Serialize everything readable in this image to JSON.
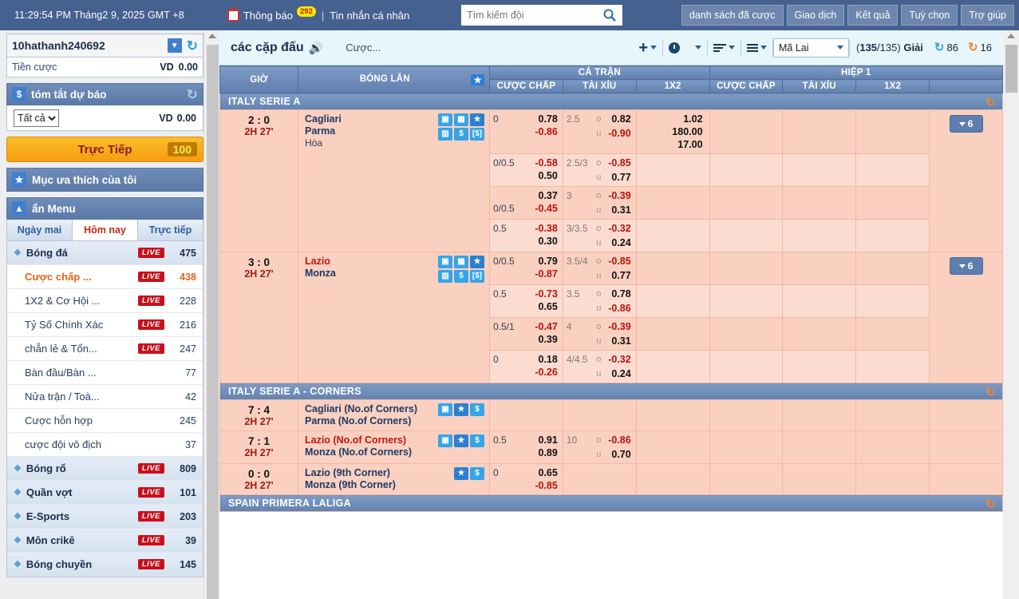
{
  "topbar": {
    "clock": "11:29:54 PM Tháng2 9, 2025 GMT +8",
    "tv_icon": "tv-icon",
    "notification_label": "Thông báo",
    "notification_count": "292",
    "separator": "|",
    "personal_message": "Tin nhắn cá nhân",
    "search_placeholder": "Tìm kiếm đội",
    "search_value": "",
    "search_icon": "search-icon",
    "nav_buttons": [
      "danh sách đã cược",
      "Giao dịch",
      "Kết quả",
      "Tuỳ chọn",
      "Trợ giúp"
    ]
  },
  "sidebar": {
    "account": {
      "username": "10hathanh240692",
      "dropdown_icon": "chevron-down-icon",
      "refresh_icon": "refresh-icon"
    },
    "balance": {
      "label": "Tiền cược",
      "currency": "VD",
      "amount": "0.00"
    },
    "forecast": {
      "dollar_icon": "dollar-icon",
      "title": "tóm tắt dự báo",
      "refresh_icon": "refresh-icon",
      "select_value": "Tất cả",
      "select_options": [
        "Tất cả"
      ],
      "currency": "VD",
      "amount": "0.00"
    },
    "live_button": {
      "label": "Trực Tiếp",
      "count": "100"
    },
    "favourites": {
      "star_icon": "star-icon",
      "label": "Mục ưa thích của tôi"
    },
    "menu_header": {
      "collapse_icon": "chevron-up-icon",
      "label": "ẩn Menu"
    },
    "tabs": [
      {
        "label": "Ngày mai",
        "active": false
      },
      {
        "label": "Hôm nay",
        "active": true
      },
      {
        "label": "Trực tiếp",
        "active": false
      }
    ],
    "live_tag": "LIVE",
    "items": [
      {
        "label": "Bóng đá",
        "type": "sport",
        "live": true,
        "count": "475",
        "highlight": false
      },
      {
        "label": "Cược chấp ...",
        "type": "sub",
        "live": true,
        "count": "438",
        "highlight": true
      },
      {
        "label": "1X2 & Cơ Hội ...",
        "type": "sub",
        "live": true,
        "count": "228",
        "highlight": false
      },
      {
        "label": "Tỷ Số Chính Xác",
        "type": "sub",
        "live": true,
        "count": "216",
        "highlight": false
      },
      {
        "label": "chẵn lẻ & Tổn...",
        "type": "sub",
        "live": true,
        "count": "247",
        "highlight": false
      },
      {
        "label": "Bàn đầu/Bàn ...",
        "type": "sub",
        "live": false,
        "count": "77",
        "highlight": false
      },
      {
        "label": "Nửa trận / Toà...",
        "type": "sub",
        "live": false,
        "count": "42",
        "highlight": false
      },
      {
        "label": "Cược hỗn hợp",
        "type": "sub",
        "live": false,
        "count": "245",
        "highlight": false
      },
      {
        "label": "cược đội vô địch",
        "type": "sub",
        "live": false,
        "count": "37",
        "highlight": false
      },
      {
        "label": "Bóng rổ",
        "type": "sport",
        "live": true,
        "count": "809",
        "highlight": false
      },
      {
        "label": "Quần vợt",
        "type": "sport",
        "live": true,
        "count": "101",
        "highlight": false
      },
      {
        "label": "E-Sports",
        "type": "sport",
        "live": true,
        "count": "203",
        "highlight": false
      },
      {
        "label": "Môn crikê",
        "type": "sport",
        "live": true,
        "count": "39",
        "highlight": false
      },
      {
        "label": "Bóng chuyền",
        "type": "sport",
        "live": true,
        "count": "145",
        "highlight": false
      }
    ]
  },
  "toolbar": {
    "title": "các cặp đấu",
    "speaker_icon": "speaker-icon",
    "bets_label": "Cược...",
    "add_icon": "plus-icon",
    "time_icon": "clock-icon",
    "sort_icon": "sort-icon",
    "list_icon": "list-icon",
    "odds_select": "Mã Lai",
    "odds_options": [
      "Mã Lai"
    ],
    "leagues_current": "135",
    "leagues_total": "135",
    "leagues_label": "Giải",
    "refresh_blue_count": "86",
    "refresh_orange_count": "16",
    "refresh_blue_color": "#3a9fd6",
    "refresh_orange_color": "#f0862a"
  },
  "table": {
    "headers": {
      "time": "GIỜ",
      "ball": "BÓNG LĂN",
      "star_icon": "star-filter-icon",
      "full_match": "CẢ TRẬN",
      "first_half": "HIỆP 1",
      "handicap": "CƯỢC CHẤP",
      "overunder": "TÀI XỈU",
      "x12": "1X2"
    },
    "league_refresh_icon": "refresh-icon",
    "over_label": "o",
    "under_label": "u",
    "sections": [
      {
        "name": "ITALY SERIE A",
        "matches": [
          {
            "score": "2 : 0",
            "minute": "2H 27'",
            "home": "Cagliari",
            "away": "Parma",
            "draw": "Hòa",
            "home_red": false,
            "icons": [
              "tv-icon",
              "pitch-icon",
              "star-icon",
              "stats-icon",
              "dollar-icon",
              "cashout-icon"
            ],
            "more_button": "6",
            "rows": [
              {
                "hcap_line": "0",
                "hcap_line_pos": "top",
                "hcap_top": "0.78",
                "hcap_top_neg": false,
                "hcap_bot": "-0.86",
                "hcap_bot_neg": true,
                "ou_line": "2.5",
                "ou_over": "0.82",
                "ou_over_neg": false,
                "ou_under": "-0.90",
                "ou_under_neg": true,
                "x12": [
                  "1.02",
                  "180.00",
                  "17.00"
                ]
              },
              {
                "hcap_line": "0/0.5",
                "hcap_line_pos": "top",
                "hcap_top": "-0.58",
                "hcap_top_neg": true,
                "hcap_bot": "0.50",
                "hcap_bot_neg": false,
                "ou_line": "2.5/3",
                "ou_over": "-0.85",
                "ou_over_neg": true,
                "ou_under": "0.77",
                "ou_under_neg": false,
                "x12": []
              },
              {
                "hcap_line": "0/0.5",
                "hcap_line_pos": "bottom",
                "hcap_top": "0.37",
                "hcap_top_neg": false,
                "hcap_bot": "-0.45",
                "hcap_bot_neg": true,
                "ou_line": "3",
                "ou_over": "-0.39",
                "ou_over_neg": true,
                "ou_under": "0.31",
                "ou_under_neg": false,
                "x12": []
              },
              {
                "hcap_line": "0.5",
                "hcap_line_pos": "top",
                "hcap_top": "-0.38",
                "hcap_top_neg": true,
                "hcap_bot": "0.30",
                "hcap_bot_neg": false,
                "ou_line": "3/3.5",
                "ou_over": "-0.32",
                "ou_over_neg": true,
                "ou_under": "0.24",
                "ou_under_neg": false,
                "x12": []
              }
            ]
          },
          {
            "score": "3 : 0",
            "minute": "2H 27'",
            "home": "Lazio",
            "away": "Monza",
            "draw": "",
            "home_red": true,
            "icons": [
              "tv-icon",
              "pitch-icon",
              "star-icon",
              "stats-icon",
              "dollar-icon",
              "cashout-icon"
            ],
            "more_button": "6",
            "rows": [
              {
                "hcap_line": "0/0.5",
                "hcap_line_pos": "top",
                "hcap_top": "0.79",
                "hcap_top_neg": false,
                "hcap_bot": "-0.87",
                "hcap_bot_neg": true,
                "ou_line": "3.5/4",
                "ou_over": "-0.85",
                "ou_over_neg": true,
                "ou_under": "0.77",
                "ou_under_neg": false,
                "x12": []
              },
              {
                "hcap_line": "0.5",
                "hcap_line_pos": "top",
                "hcap_top": "-0.73",
                "hcap_top_neg": true,
                "hcap_bot": "0.65",
                "hcap_bot_neg": false,
                "ou_line": "3.5",
                "ou_over": "0.78",
                "ou_over_neg": false,
                "ou_under": "-0.86",
                "ou_under_neg": true,
                "x12": []
              },
              {
                "hcap_line": "0.5/1",
                "hcap_line_pos": "top",
                "hcap_top": "-0.47",
                "hcap_top_neg": true,
                "hcap_bot": "0.39",
                "hcap_bot_neg": false,
                "ou_line": "4",
                "ou_over": "-0.39",
                "ou_over_neg": true,
                "ou_under": "0.31",
                "ou_under_neg": false,
                "x12": []
              },
              {
                "hcap_line": "0",
                "hcap_line_pos": "top",
                "hcap_top": "0.18",
                "hcap_top_neg": false,
                "hcap_bot": "-0.26",
                "hcap_bot_neg": true,
                "ou_line": "4/4.5",
                "ou_over": "-0.32",
                "ou_over_neg": true,
                "ou_under": "0.24",
                "ou_under_neg": false,
                "x12": []
              }
            ]
          }
        ]
      },
      {
        "name": "ITALY SERIE A - CORNERS",
        "matches": [
          {
            "score": "7 : 4",
            "minute": "2H 27'",
            "home": "Cagliari (No.of Corners)",
            "away": "Parma (No.of Corners)",
            "draw": "",
            "home_red": false,
            "icons": [
              "tv-icon",
              "star-icon",
              "dollar-icon"
            ],
            "more_button": "",
            "rows": [
              {
                "hcap_line": "",
                "hcap_line_pos": "top",
                "hcap_top": "",
                "hcap_top_neg": false,
                "hcap_bot": "",
                "hcap_bot_neg": false,
                "ou_line": "",
                "ou_over": "",
                "ou_over_neg": false,
                "ou_under": "",
                "ou_under_neg": false,
                "x12": []
              }
            ]
          },
          {
            "score": "7 : 1",
            "minute": "2H 27'",
            "home": "Lazio (No.of Corners)",
            "away": "Monza (No.of Corners)",
            "draw": "",
            "home_red": true,
            "icons": [
              "tv-icon",
              "star-icon",
              "dollar-icon"
            ],
            "more_button": "",
            "rows": [
              {
                "hcap_line": "0.5",
                "hcap_line_pos": "top",
                "hcap_top": "0.91",
                "hcap_top_neg": false,
                "hcap_bot": "0.89",
                "hcap_bot_neg": false,
                "ou_line": "10",
                "ou_over": "-0.86",
                "ou_over_neg": true,
                "ou_under": "0.70",
                "ou_under_neg": false,
                "x12": []
              }
            ]
          },
          {
            "score": "0 : 0",
            "minute": "2H 27'",
            "home": "Lazio (9th Corner)",
            "away": "Monza (9th Corner)",
            "draw": "",
            "home_red": false,
            "icons": [
              "star-icon",
              "dollar-icon"
            ],
            "more_button": "",
            "rows": [
              {
                "hcap_line": "0",
                "hcap_line_pos": "top",
                "hcap_top": "0.65",
                "hcap_top_neg": false,
                "hcap_bot": "-0.85",
                "hcap_bot_neg": true,
                "ou_line": "",
                "ou_over": "",
                "ou_over_neg": false,
                "ou_under": "",
                "ou_under_neg": false,
                "x12": []
              }
            ]
          }
        ]
      },
      {
        "name": "SPAIN PRIMERA LALIGA",
        "matches": []
      }
    ]
  }
}
